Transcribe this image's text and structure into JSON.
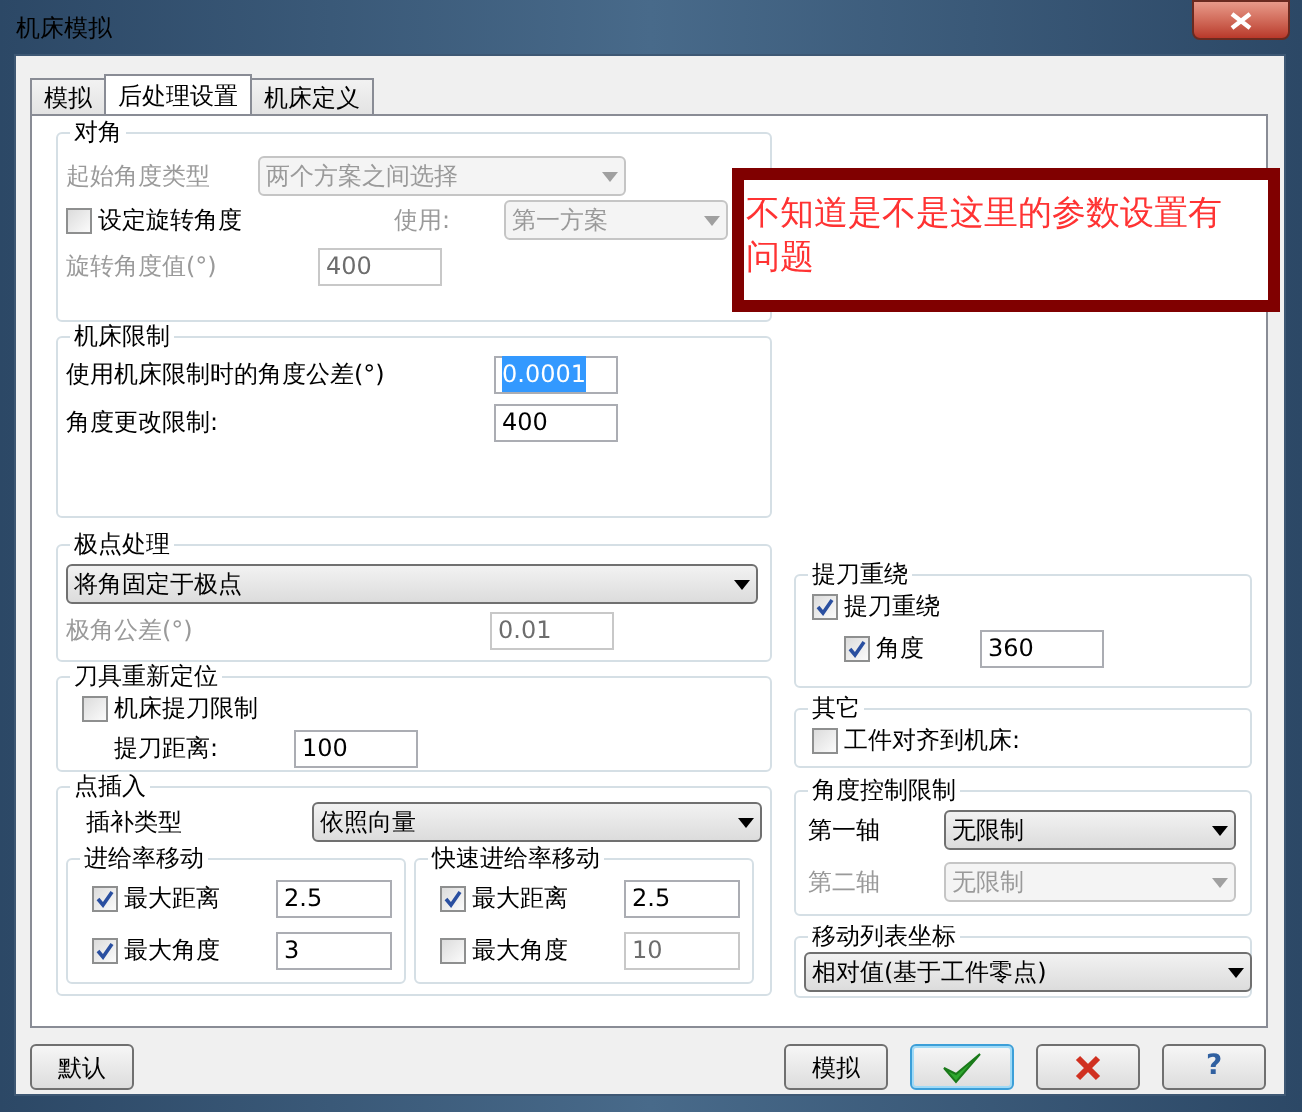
{
  "window": {
    "title": "机床模拟"
  },
  "tabs": [
    {
      "label": "模拟",
      "selected": false
    },
    {
      "label": "后处理设置",
      "selected": true
    },
    {
      "label": "机床定义",
      "selected": false
    }
  ],
  "diagonal": {
    "title": "对角",
    "start_type": {
      "label": "起始角度类型",
      "value": "两个方案之间选择",
      "disabled": true
    },
    "set_rotation": {
      "label": "设定旋转角度",
      "checked": false
    },
    "use": {
      "label": "使用:",
      "value": "第一方案",
      "disabled": true
    },
    "rotation_value": {
      "label": "旋转角度值(°)",
      "value": "400",
      "disabled": true
    }
  },
  "machine_limits": {
    "title": "机床限制",
    "fields": [
      {
        "label": "使用机床限制时的角度公差(°)",
        "value": "0.0001",
        "selected": true
      },
      {
        "label": "角度更改限制:",
        "value": "400",
        "selected": false
      }
    ]
  },
  "pole": {
    "title": "极点处理",
    "select": {
      "value": "将角固定于极点"
    },
    "tolerance": {
      "label": "极角公差(°)",
      "value": "0.01",
      "disabled": true
    }
  },
  "tool_reposition": {
    "title": "刀具重新定位",
    "limit": {
      "label": "机床提刀限制",
      "checked": false
    },
    "distance": {
      "label": "提刀距离:",
      "value": "100"
    }
  },
  "point_insert": {
    "title": "点插入",
    "interp": {
      "label": "插补类型",
      "value": "依照向量"
    },
    "subgroups": [
      {
        "title": "进给率移动",
        "rows": [
          {
            "label": "最大距离",
            "checked": true,
            "value": "2.5"
          },
          {
            "label": "最大角度",
            "checked": true,
            "value": "3"
          }
        ]
      },
      {
        "title": "快速进给率移动",
        "rows": [
          {
            "label": "最大距离",
            "checked": true,
            "value": "2.5"
          },
          {
            "label": "最大角度",
            "checked": false,
            "value": "10"
          }
        ]
      }
    ]
  },
  "retract_rewind": {
    "title": "提刀重绕",
    "main": {
      "label": "提刀重绕",
      "checked": true
    },
    "angle": {
      "label": "角度",
      "checked": true,
      "value": "360"
    }
  },
  "other": {
    "title": "其它",
    "align": {
      "label": "工件对齐到机床:",
      "checked": false
    }
  },
  "angle_control": {
    "title": "角度控制限制",
    "axes": [
      {
        "label": "第一轴",
        "value": "无限制",
        "disabled": false
      },
      {
        "label": "第二轴",
        "value": "无限制",
        "disabled": true
      }
    ]
  },
  "move_list": {
    "title": "移动列表坐标",
    "select": {
      "value": "相对值(基于工件零点)"
    }
  },
  "annotation": {
    "text": "不知道是不是这里的参数设置有问题"
  },
  "buttons": [
    {
      "kind": "text",
      "label": "默认",
      "focused": false
    },
    {
      "kind": "text",
      "label": "模拟",
      "focused": false
    },
    {
      "kind": "ok",
      "focused": true
    },
    {
      "kind": "cancel",
      "focused": false
    },
    {
      "kind": "help",
      "label": "?",
      "focused": false
    }
  ]
}
